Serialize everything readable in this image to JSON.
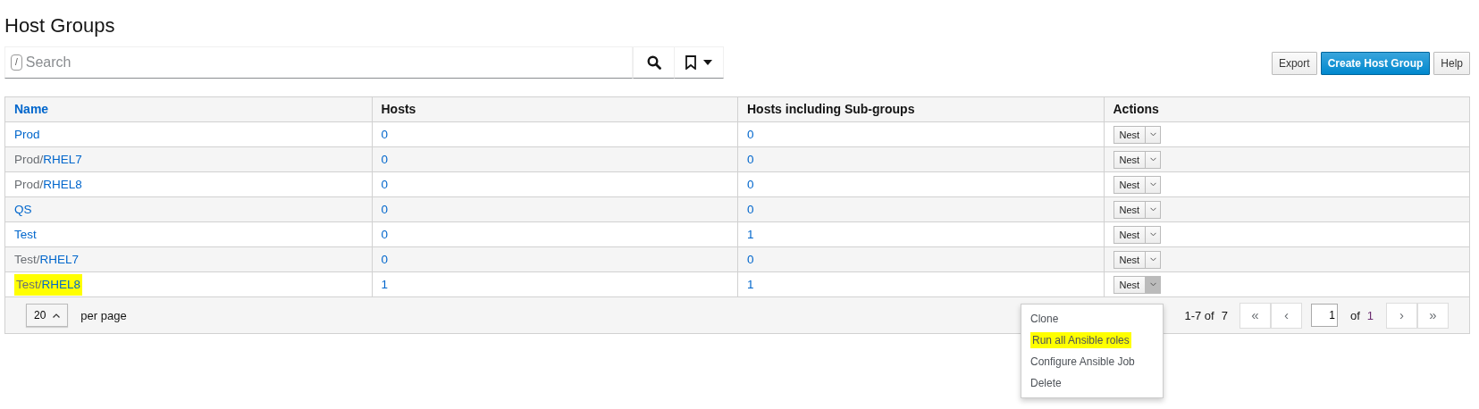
{
  "title": "Host Groups",
  "search": {
    "shortcut": "/",
    "placeholder": "Search"
  },
  "buttons": [
    {
      "label": "Export",
      "kind": "default"
    },
    {
      "label": "Create Host Group",
      "kind": "primary"
    },
    {
      "label": "Help",
      "kind": "default"
    }
  ],
  "table": {
    "columns": [
      {
        "label": "Name",
        "sortable": true
      },
      {
        "label": "Hosts",
        "sortable": false
      },
      {
        "label": "Hosts including Sub-groups",
        "sortable": false
      },
      {
        "label": "Actions",
        "sortable": false
      }
    ],
    "rows": [
      {
        "parent": "",
        "name": "Prod",
        "hosts": "0",
        "hosts_sub": "0",
        "action": "Nest",
        "highlighted": false,
        "menu_open": false
      },
      {
        "parent": "Prod/",
        "name": "RHEL7",
        "hosts": "0",
        "hosts_sub": "0",
        "action": "Nest",
        "highlighted": false,
        "menu_open": false
      },
      {
        "parent": "Prod/",
        "name": "RHEL8",
        "hosts": "0",
        "hosts_sub": "0",
        "action": "Nest",
        "highlighted": false,
        "menu_open": false
      },
      {
        "parent": "",
        "name": "QS",
        "hosts": "0",
        "hosts_sub": "0",
        "action": "Nest",
        "highlighted": false,
        "menu_open": false
      },
      {
        "parent": "",
        "name": "Test",
        "hosts": "0",
        "hosts_sub": "1",
        "action": "Nest",
        "highlighted": false,
        "menu_open": false
      },
      {
        "parent": "Test/",
        "name": "RHEL7",
        "hosts": "0",
        "hosts_sub": "0",
        "action": "Nest",
        "highlighted": false,
        "menu_open": false
      },
      {
        "parent": "Test/",
        "name": "RHEL8",
        "hosts": "1",
        "hosts_sub": "1",
        "action": "Nest",
        "highlighted": true,
        "menu_open": true
      }
    ]
  },
  "action_menu": [
    {
      "label": "Clone",
      "highlighted": false
    },
    {
      "label": "Run all Ansible roles",
      "highlighted": true
    },
    {
      "label": "Configure Ansible Job",
      "highlighted": false
    },
    {
      "label": "Delete",
      "highlighted": false
    }
  ],
  "pagination": {
    "per_page": "20",
    "per_page_label": "per page",
    "range": "1-7 of",
    "total": "7",
    "first": "«",
    "prev": "‹",
    "page": "1",
    "of": "of",
    "pages": "1",
    "next": "›",
    "last": "»"
  }
}
